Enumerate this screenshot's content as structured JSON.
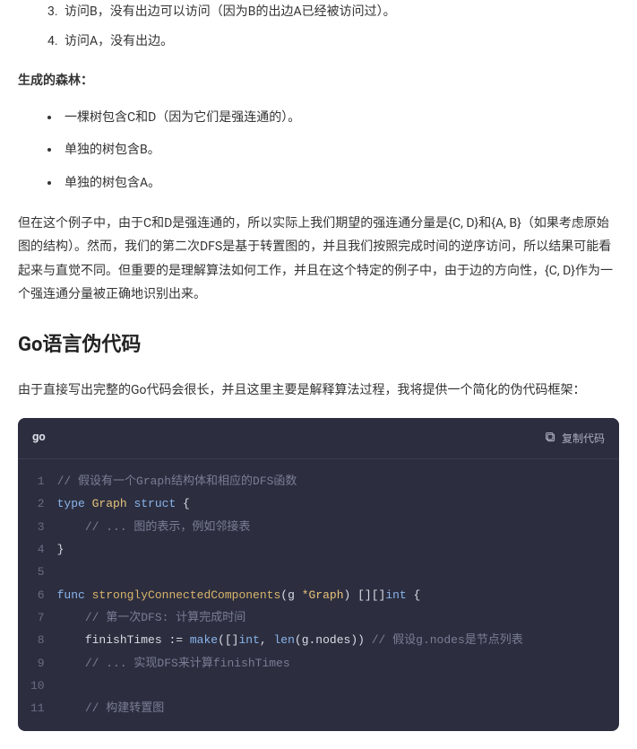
{
  "ordered_list": [
    {
      "index": "3.",
      "text": "访问B，没有出边可以访问（因为B的出边A已经被访问过）。"
    },
    {
      "index": "4.",
      "text": "访问A，没有出边。"
    }
  ],
  "forest_label": "生成的森林：",
  "forest_items": [
    "一棵树包含C和D（因为它们是强连通的）。",
    "单独的树包含B。",
    "单独的树包含A。"
  ],
  "paragraph": "但在这个例子中，由于C和D是强连通的，所以实际上我们期望的强连通分量是{C, D}和{A, B}（如果考虑原始图的结构）。然而，我们的第二次DFS是基于转置图的，并且我们按照完成时间的逆序访问，所以结果可能看起来与直觉不同。但重要的是理解算法如何工作，并且在这个特定的例子中，由于边的方向性，{C, D}作为一个强连通分量被正确地识别出来。",
  "section_title": "Go语言伪代码",
  "intro_paragraph": "由于直接写出完整的Go代码会很长，并且这里主要是解释算法过程，我将提供一个简化的伪代码框架：",
  "code": {
    "lang": "go",
    "copy_label": "复制代码",
    "lines": [
      {
        "n": 1,
        "tokens": [
          {
            "c": "comment",
            "t": "// 假设有一个Graph结构体和相应的DFS函数"
          }
        ]
      },
      {
        "n": 2,
        "tokens": [
          {
            "c": "keyword",
            "t": "type "
          },
          {
            "c": "type",
            "t": "Graph"
          },
          {
            "c": "keyword",
            "t": " struct"
          },
          {
            "c": "punc",
            "t": " {"
          }
        ]
      },
      {
        "n": 3,
        "tokens": [
          {
            "c": "plain",
            "t": "    "
          },
          {
            "c": "comment",
            "t": "// ... 图的表示，例如邻接表"
          }
        ]
      },
      {
        "n": 4,
        "tokens": [
          {
            "c": "punc",
            "t": "}"
          }
        ]
      },
      {
        "n": 5,
        "tokens": [
          {
            "c": "plain",
            "t": ""
          }
        ]
      },
      {
        "n": 6,
        "tokens": [
          {
            "c": "keyword",
            "t": "func "
          },
          {
            "c": "func",
            "t": "stronglyConnectedComponents"
          },
          {
            "c": "punc",
            "t": "("
          },
          {
            "c": "ident",
            "t": "g "
          },
          {
            "c": "type",
            "t": "*Graph"
          },
          {
            "c": "punc",
            "t": ") [][]"
          },
          {
            "c": "keyword",
            "t": "int"
          },
          {
            "c": "punc",
            "t": " {"
          }
        ]
      },
      {
        "n": 7,
        "tokens": [
          {
            "c": "plain",
            "t": "    "
          },
          {
            "c": "comment",
            "t": "// 第一次DFS: 计算完成时间"
          }
        ]
      },
      {
        "n": 8,
        "tokens": [
          {
            "c": "plain",
            "t": "    "
          },
          {
            "c": "ident",
            "t": "finishTimes "
          },
          {
            "c": "operator",
            "t": ":= "
          },
          {
            "c": "builtin",
            "t": "make"
          },
          {
            "c": "punc",
            "t": "([]"
          },
          {
            "c": "keyword",
            "t": "int"
          },
          {
            "c": "punc",
            "t": ", "
          },
          {
            "c": "builtin",
            "t": "len"
          },
          {
            "c": "punc",
            "t": "(g.nodes)) "
          },
          {
            "c": "comment",
            "t": "// 假设g.nodes是节点列表"
          }
        ]
      },
      {
        "n": 9,
        "tokens": [
          {
            "c": "plain",
            "t": "    "
          },
          {
            "c": "comment",
            "t": "// ... 实现DFS来计算finishTimes"
          }
        ]
      },
      {
        "n": 10,
        "tokens": [
          {
            "c": "plain",
            "t": ""
          }
        ]
      },
      {
        "n": 11,
        "tokens": [
          {
            "c": "plain",
            "t": "    "
          },
          {
            "c": "comment",
            "t": "// 构建转置图"
          }
        ]
      }
    ]
  }
}
